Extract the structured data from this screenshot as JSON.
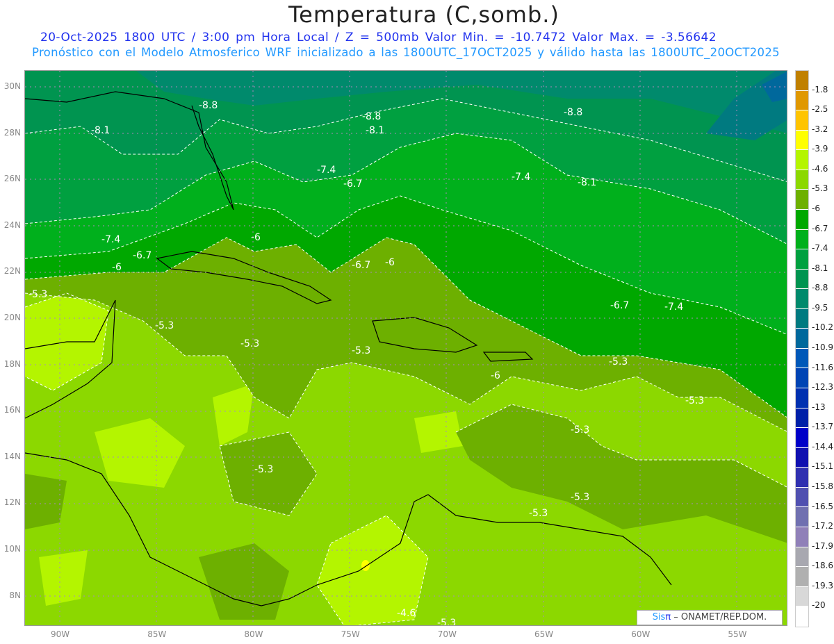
{
  "title": "Temperatura (C,somb.)",
  "subtitle1": "20-Oct-2025  1800 UTC / 3:00 pm Hora Local / Z = 500mb  Valor Min. = -10.7472  Valor Max. = -3.56642",
  "subtitle2": "Pronóstico con el Modelo Atmosferico WRF inicializado a las 1800UTC_17OCT2025 y válido hasta las  1800UTC_20OCT2025",
  "lat_labels": [
    "30N",
    "28N",
    "26N",
    "24N",
    "22N",
    "20N",
    "18N",
    "16N",
    "14N",
    "12N",
    "10N",
    "8N"
  ],
  "lon_labels": [
    "90W",
    "85W",
    "80W",
    "75W",
    "70W",
    "65W",
    "60W",
    "55W"
  ],
  "contour_labels": [
    "-8.8",
    "-8.1",
    "-8.8",
    "-8.1",
    "-8.8",
    "-7.4",
    "-6.7",
    "-7.4",
    "-8.1",
    "-7.4",
    "-6.7",
    "-6",
    "-6",
    "-6.7",
    "-6",
    "-5.3",
    "-6.7",
    "-7.4",
    "-5.3",
    "-5.3",
    "-5.3",
    "-5.3",
    "-6",
    "-5.3",
    "-5.3",
    "-5.3",
    "-5.3",
    "-5.3",
    "-4.6",
    "-5.3"
  ],
  "colorbar": {
    "labels": [
      "-1.8",
      "-2.5",
      "-3.2",
      "-3.9",
      "-4.6",
      "-5.3",
      "-6",
      "-6.7",
      "-7.4",
      "-8.1",
      "-8.8",
      "-9.5",
      "-10.2",
      "-10.9",
      "-11.6",
      "-12.3",
      "-13",
      "-13.7",
      "-14.4",
      "-15.1",
      "-15.8",
      "-16.5",
      "-17.2",
      "-17.9",
      "-18.6",
      "-19.3",
      "-20"
    ],
    "colors": [
      "#c08000",
      "#e09800",
      "#ffc400",
      "#ffff00",
      "#b4f500",
      "#8cd800",
      "#6db000",
      "#00a800",
      "#00b01c",
      "#00a040",
      "#009450",
      "#008a6c",
      "#007a80",
      "#00689c",
      "#0058b8",
      "#0044b4",
      "#0030b0",
      "#0020a8",
      "#0000c8",
      "#1010b0",
      "#3030b0",
      "#5050b0",
      "#7070b0",
      "#9080b8",
      "#a8a8b0",
      "#b0b0b0",
      "#d8d8d8",
      "#ffffff"
    ]
  },
  "credit": {
    "brand_a": "Sis",
    "brand_b": "π",
    "text": " –  ONAMET/REP.DOM."
  }
}
